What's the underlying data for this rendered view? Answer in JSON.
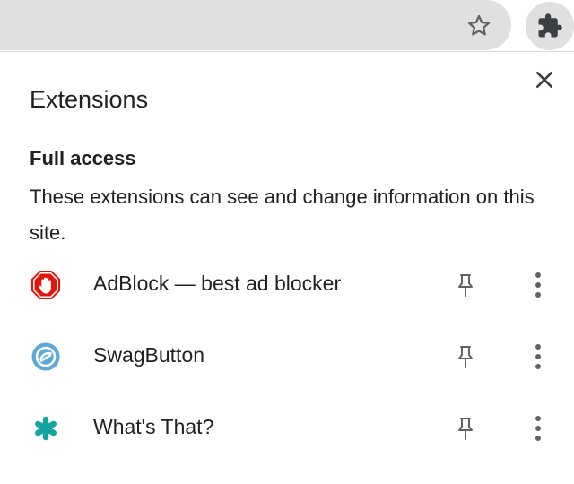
{
  "toolbar": {
    "bookmark_icon": "star-outline-icon",
    "extensions_icon": "puzzle-piece-icon",
    "omnibox_color": "#e0e0e0"
  },
  "popup": {
    "title": "Extensions",
    "close_icon": "close-icon",
    "section": {
      "heading": "Full access",
      "description": "These extensions can see and change information on this site."
    },
    "extensions": [
      {
        "name": "AdBlock — best ad blocker",
        "icon": "adblock-stop-hand-icon",
        "icon_color": "#e3140b"
      },
      {
        "name": "SwagButton",
        "icon": "swagbutton-icon",
        "icon_color": "#5aa9d6"
      },
      {
        "name": "What's That?",
        "icon": "whats-that-asterisk-icon",
        "icon_color": "#12a5a2"
      }
    ],
    "pin_icon": "pin-icon",
    "more_icon": "more-vert-icon"
  }
}
